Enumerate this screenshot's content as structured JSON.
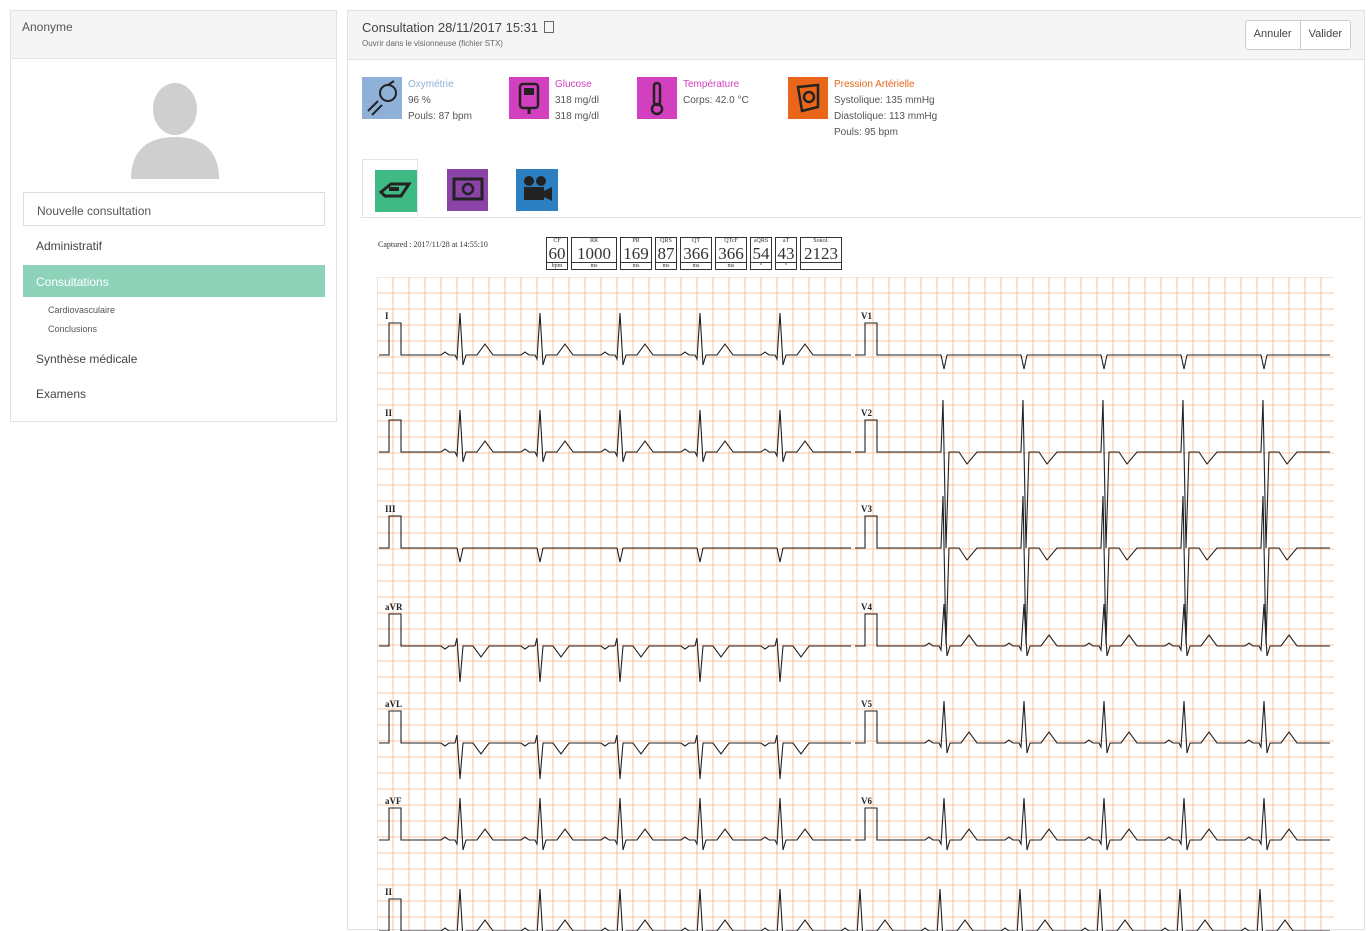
{
  "patient": {
    "name": "Anonyme"
  },
  "sidebar": {
    "new_consult_label": "Nouvelle consultation",
    "items": [
      {
        "label": "Administratif"
      },
      {
        "label": "Consultations"
      },
      {
        "label": "Synthèse médicale"
      },
      {
        "label": "Examens"
      }
    ],
    "sub_items": [
      {
        "label": "Cardiovasculaire"
      },
      {
        "label": "Conclusions"
      }
    ]
  },
  "header": {
    "title": "Consultation 28/11/2017 15:31",
    "subtitle": "Ouvrir dans le visionneuse (fichier STX)",
    "cancel_label": "Annuler",
    "validate_label": "Valider"
  },
  "vitals": {
    "oxymetry": {
      "title": "Oxymétrie",
      "line1": "96 %",
      "line2": "Pouls: 87 bpm",
      "color": "#8fb0d8"
    },
    "glucose": {
      "title": "Glucose",
      "line1": "318 mg/dl",
      "line2": "318 mg/dl",
      "color": "#d23fbf"
    },
    "temperature": {
      "title": "Température",
      "line1": "Corps: 42.0 °C",
      "color": "#d23fbf"
    },
    "pressure": {
      "title": "Pression Artérielle",
      "line1": "Systolique: 135 mmHg",
      "line2": "Diastolique: 113 mmHg",
      "line3": "Pouls: 95 bpm",
      "color": "#e8651a"
    }
  },
  "tabs": [
    {
      "icon": "ecg-icon",
      "color": "#3fba84"
    },
    {
      "icon": "camera-icon",
      "color": "#8a44a8"
    },
    {
      "icon": "video-camera-icon",
      "color": "#2c7fc0"
    }
  ],
  "ecg": {
    "captured": "Captured : 2017/11/28 at 14:55:10",
    "measures": [
      {
        "label": "CF",
        "value": "60",
        "unit": "bpm"
      },
      {
        "label": "RR",
        "value": "1000",
        "unit": "ms"
      },
      {
        "label": "PR",
        "value": "169",
        "unit": "ms"
      },
      {
        "label": "QRS",
        "value": "87",
        "unit": "ms"
      },
      {
        "label": "QT",
        "value": "366",
        "unit": "ms"
      },
      {
        "label": "QTcF",
        "value": "366",
        "unit": "ms"
      },
      {
        "label": "aQRS",
        "value": "54",
        "unit": "°"
      },
      {
        "label": "aT",
        "value": "43",
        "unit": "°"
      },
      {
        "label": "Sokol.",
        "value": "2123",
        "unit": ""
      }
    ],
    "leads_left": [
      "I",
      "II",
      "III",
      "aVR",
      "aVL",
      "aVF",
      "II"
    ],
    "leads_right": [
      "V1",
      "V2",
      "V3",
      "V4",
      "V5",
      "V6"
    ],
    "grid_color": "#f0b28c"
  }
}
